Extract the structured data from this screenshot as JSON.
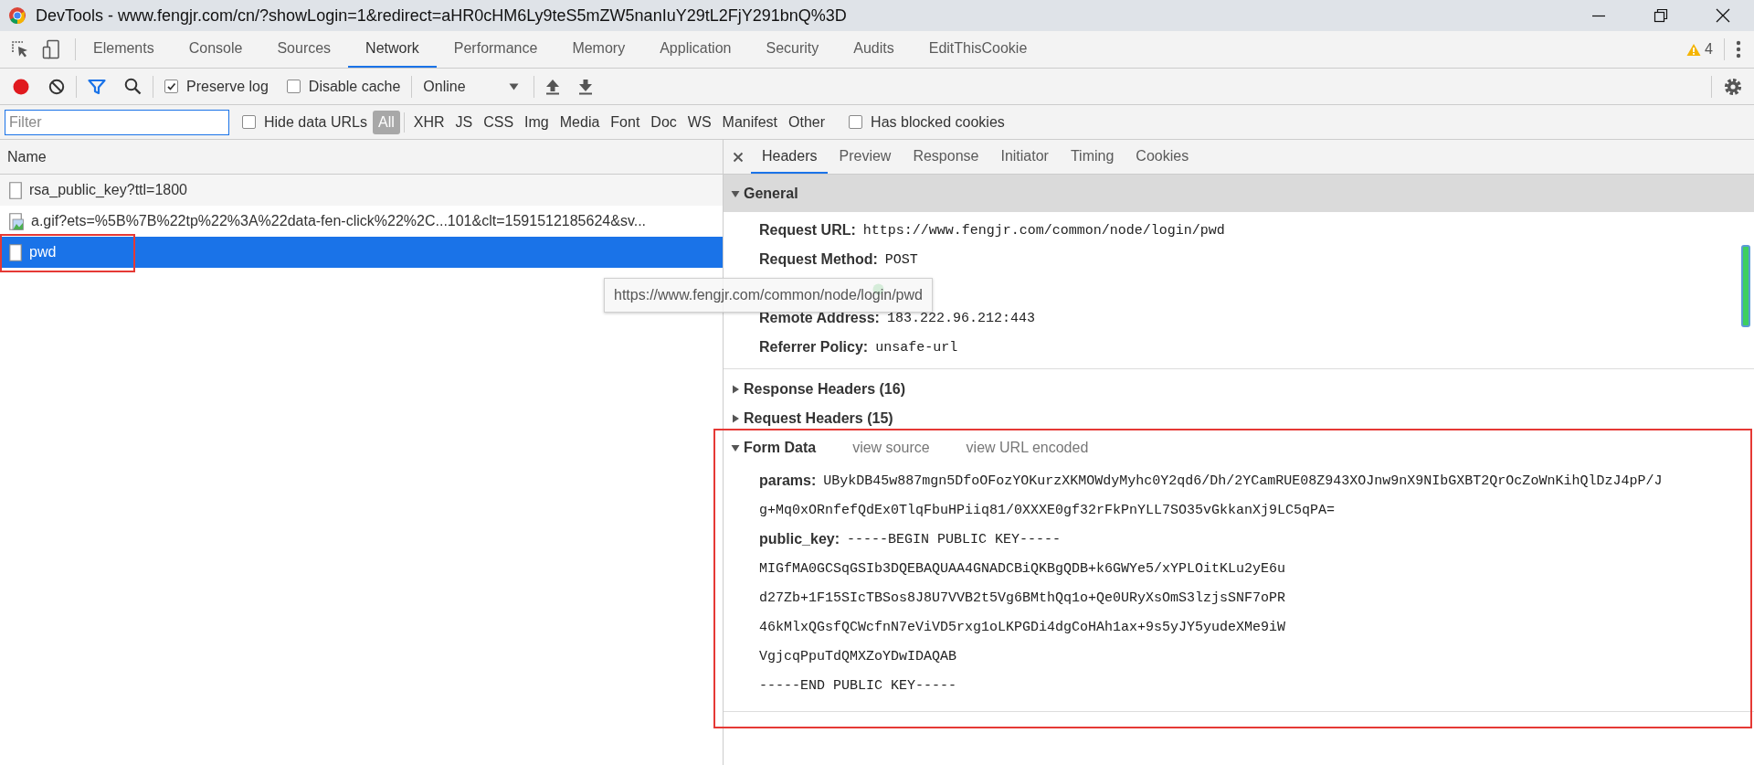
{
  "window": {
    "title": "DevTools - www.fengjr.com/cn/?showLogin=1&redirect=aHR0cHM6Ly9teS5mZW5nanIuY29tL2FjY291bnQ%3D"
  },
  "panel_tabs": [
    {
      "label": "Elements",
      "selected": false
    },
    {
      "label": "Console",
      "selected": false
    },
    {
      "label": "Sources",
      "selected": false
    },
    {
      "label": "Network",
      "selected": true
    },
    {
      "label": "Performance",
      "selected": false
    },
    {
      "label": "Memory",
      "selected": false
    },
    {
      "label": "Application",
      "selected": false
    },
    {
      "label": "Security",
      "selected": false
    },
    {
      "label": "Audits",
      "selected": false
    },
    {
      "label": "EditThisCookie",
      "selected": false
    }
  ],
  "warnings": {
    "count": "4"
  },
  "toolbar": {
    "recording": true,
    "checkboxes": [
      {
        "label": "Preserve log",
        "checked": true
      },
      {
        "label": "Disable cache",
        "checked": false
      }
    ],
    "throttling": "Online"
  },
  "filter_bar": {
    "placeholder": "Filter",
    "hide_data_urls": {
      "label": "Hide data URLs",
      "checked": false
    },
    "types": [
      {
        "label": "All",
        "selected": true
      },
      {
        "label": "XHR",
        "selected": false
      },
      {
        "label": "JS",
        "selected": false
      },
      {
        "label": "CSS",
        "selected": false
      },
      {
        "label": "Img",
        "selected": false
      },
      {
        "label": "Media",
        "selected": false
      },
      {
        "label": "Font",
        "selected": false
      },
      {
        "label": "Doc",
        "selected": false
      },
      {
        "label": "WS",
        "selected": false
      },
      {
        "label": "Manifest",
        "selected": false
      },
      {
        "label": "Other",
        "selected": false
      }
    ],
    "has_blocked_cookies": {
      "label": "Has blocked cookies",
      "checked": false
    }
  },
  "requests": {
    "column": "Name",
    "rows": [
      {
        "name": "rsa_public_key?ttl=1800",
        "kind": "document",
        "selected": false,
        "highlighted": false
      },
      {
        "name": "a.gif?ets=%5B%7B%22tp%22%3A%22data-fen-click%22%2C...101&clt=1591512185624&sv...",
        "kind": "image",
        "selected": false,
        "highlighted": false
      },
      {
        "name": "pwd",
        "kind": "document",
        "selected": true,
        "highlighted": true
      }
    ]
  },
  "tooltip": "https://www.fengjr.com/common/node/login/pwd",
  "details": {
    "tabs": [
      {
        "label": "Headers",
        "selected": true
      },
      {
        "label": "Preview",
        "selected": false
      },
      {
        "label": "Response",
        "selected": false
      },
      {
        "label": "Initiator",
        "selected": false
      },
      {
        "label": "Timing",
        "selected": false
      },
      {
        "label": "Cookies",
        "selected": false
      }
    ],
    "sections": [
      {
        "title": "General",
        "expanded": true,
        "highlighted": false,
        "rows": [
          {
            "key": "Request URL:",
            "lines": [
              "https://www.fengjr.com/common/node/login/pwd"
            ]
          },
          {
            "key": "Request Method:",
            "lines": [
              "POST"
            ]
          },
          {
            "status_ok": true
          },
          {
            "key": "Remote Address:",
            "lines": [
              "183.222.96.212:443"
            ]
          },
          {
            "key": "Referrer Policy:",
            "lines": [
              "unsafe-url"
            ]
          }
        ]
      },
      {
        "title": "Response Headers (16)",
        "expanded": false,
        "highlighted": false
      },
      {
        "title": "Request Headers (15)",
        "expanded": false,
        "highlighted": false
      },
      {
        "title": "Form Data",
        "expanded": true,
        "highlighted": true,
        "links": [
          "view source",
          "view URL encoded"
        ],
        "rows": [
          {
            "key": "params:",
            "lines": [
              "UBykDB45w887mgn5DfoOFozYOKurzXKMOWdyMyhc0Y2qd6/Dh/2YCamRUE08Z943XOJnw9nX9NIbGXBT2QrOcZoWnKihQlDzJ4pP/J",
              "g+Mq0xORnfefQdEx0TlqFbuHPiiq81/0XXXE0gf32rFkPnYLL7SO35vGkkanXj9LC5qPA="
            ]
          },
          {
            "key": "public_key:",
            "lines": [
              "-----BEGIN PUBLIC KEY-----",
              "MIGfMA0GCSqGSIb3DQEBAQUAA4GNADCBiQKBgQDB+k6GWYe5/xYPLOitKLu2yE6u",
              "d27Zb+1F15SIcTBSos8J8U7VVB2t5Vg6BMthQq1o+Qe0URyXsOmS3lzjsSNF7oPR",
              "46kMlxQGsfQCWcfnN7eViVD5rxg1oLKPGDi4dgCoHAh1ax+9s5yJY5yudeXMe9iW",
              "VgjcqPpuTdQMXZoYDwIDAQAB",
              "-----END PUBLIC KEY-----"
            ]
          }
        ]
      }
    ]
  }
}
